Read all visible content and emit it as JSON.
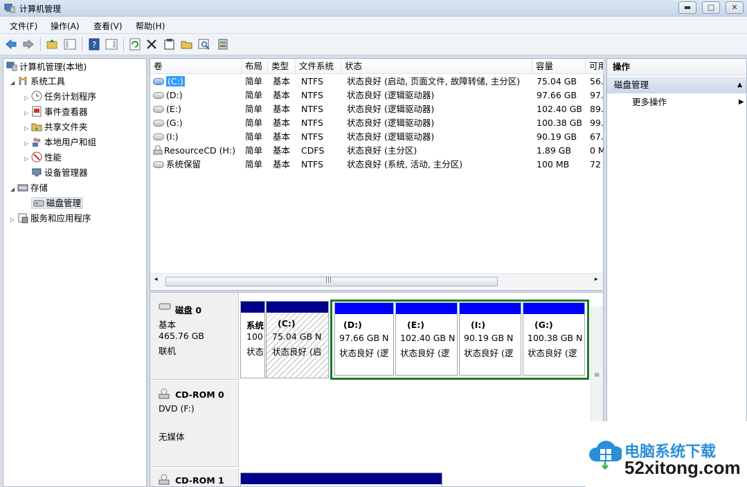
{
  "window": {
    "title": "计算机管理",
    "minimize": "▬",
    "maximize": "□",
    "close": "✕"
  },
  "menu": [
    "文件(F)",
    "操作(A)",
    "查看(V)",
    "帮助(H)"
  ],
  "toolbar_icons": [
    "back-icon",
    "forward-icon",
    "up-folder-icon",
    "show-hide-tree-icon",
    "help-icon",
    "show-action-pane-icon",
    "refresh-icon",
    "delete-icon",
    "properties-icon",
    "open-icon",
    "search-icon",
    "disk-settings-icon"
  ],
  "tree": {
    "root": "计算机管理(本地)",
    "system_tools": "系统工具",
    "task_scheduler": "任务计划程序",
    "event_viewer": "事件查看器",
    "shared_folders": "共享文件夹",
    "local_users": "本地用户和组",
    "performance": "性能",
    "device_manager": "设备管理器",
    "storage": "存储",
    "disk_management": "磁盘管理",
    "services_apps": "服务和应用程序"
  },
  "volumes": {
    "columns": [
      "卷",
      "布局",
      "类型",
      "文件系统",
      "状态",
      "容量",
      "可用"
    ],
    "rows": [
      {
        "vol": "(C:)",
        "layout": "简单",
        "type": "基本",
        "fs": "NTFS",
        "status": "状态良好 (启动, 页面文件, 故障转储, 主分区)",
        "capacity": "75.04 GB",
        "free": "56."
      },
      {
        "vol": "(D:)",
        "layout": "简单",
        "type": "基本",
        "fs": "NTFS",
        "status": "状态良好 (逻辑驱动器)",
        "capacity": "97.66 GB",
        "free": "97."
      },
      {
        "vol": "(E:)",
        "layout": "简单",
        "type": "基本",
        "fs": "NTFS",
        "status": "状态良好 (逻辑驱动器)",
        "capacity": "102.40 GB",
        "free": "89."
      },
      {
        "vol": "(G:)",
        "layout": "简单",
        "type": "基本",
        "fs": "NTFS",
        "status": "状态良好 (逻辑驱动器)",
        "capacity": "100.38 GB",
        "free": "99."
      },
      {
        "vol": "(I:)",
        "layout": "简单",
        "type": "基本",
        "fs": "NTFS",
        "status": "状态良好 (逻辑驱动器)",
        "capacity": "90.19 GB",
        "free": "67."
      },
      {
        "vol": "ResourceCD (H:)",
        "layout": "简单",
        "type": "基本",
        "fs": "CDFS",
        "status": "状态良好 (主分区)",
        "capacity": "1.89 GB",
        "free": "0 M"
      },
      {
        "vol": "系统保留",
        "layout": "简单",
        "type": "基本",
        "fs": "NTFS",
        "status": "状态良好 (系统, 活动, 主分区)",
        "capacity": "100 MB",
        "free": "72"
      }
    ],
    "scroll_grip": "|||"
  },
  "disks": {
    "disk0": {
      "name": "磁盘 0",
      "type": "基本",
      "size": "465.76 GB",
      "state": "联机"
    },
    "cdrom0": {
      "name": "CD-ROM 0",
      "drive": "DVD (F:)",
      "media": "无媒体"
    },
    "cdrom1": {
      "name": "CD-ROM 1"
    },
    "partitions": [
      {
        "label": "系统",
        "size": "100",
        "status": "状态"
      },
      {
        "label": "(C:)",
        "size": "75.04 GB N",
        "status": "状态良好 (启"
      },
      {
        "label": "(D:)",
        "size": "97.66 GB N",
        "status": "状态良好 (逻"
      },
      {
        "label": "(E:)",
        "size": "102.40 GB N",
        "status": "状态良好 (逻"
      },
      {
        "label": "(I:)",
        "size": "90.19 GB N",
        "status": "状态良好 (逻"
      },
      {
        "label": "(G:)",
        "size": "100.38 GB N",
        "status": "状态良好 (逻"
      }
    ],
    "scroll_grip": "≡"
  },
  "actions": {
    "header": "操作",
    "group": "磁盘管理",
    "more": "更多操作",
    "collapse_glyph": "▲",
    "more_glyph": "▶"
  },
  "watermark": {
    "cn": "电脑系统下载",
    "en": "52xitong.com"
  },
  "colors": {
    "primary_partition": "#00008b",
    "logical_drive": "#0000ff",
    "extended_partition": "#1b7a2a",
    "selection": "#3399ff"
  }
}
